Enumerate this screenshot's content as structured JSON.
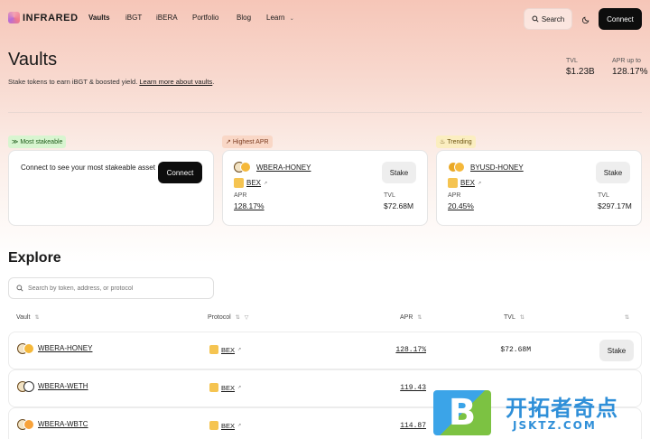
{
  "nav": {
    "logo_text": "INFRARED",
    "links": [
      "Vaults",
      "iBGT",
      "iBERA",
      "Portfolio",
      "Blog",
      "Learn"
    ],
    "search_label": "Search",
    "connect_label": "Connect"
  },
  "header": {
    "title": "Vaults",
    "subtitle": "Stake tokens to earn iBGT & boosted yield.",
    "learn_more": "Learn more about vaults",
    "tvl_label": "TVL",
    "tvl_value": "$1.23B",
    "apr_label": "APR up to",
    "apr_value": "128.17%"
  },
  "cards": {
    "most_stakeable": {
      "tag": "Most stakeable",
      "text": "Connect to see your most stakeable asset",
      "button": "Connect"
    },
    "highest_apr": {
      "tag": "Highest APR",
      "pair": "WBERA-HONEY",
      "protocol": "BEX",
      "button": "Stake",
      "apr_label": "APR",
      "apr_value": "128.17%",
      "tvl_label": "TVL",
      "tvl_value": "$72.68M"
    },
    "trending": {
      "tag": "Trending",
      "pair": "BYUSD-HONEY",
      "protocol": "BEX",
      "button": "Stake",
      "apr_label": "APR",
      "apr_value": "20.45%",
      "tvl_label": "TVL",
      "tvl_value": "$297.17M"
    }
  },
  "explore": {
    "title": "Explore",
    "search_placeholder": "Search by token, address, or protocol",
    "columns": {
      "vault": "Vault",
      "protocol": "Protocol",
      "apr": "APR",
      "tvl": "TVL"
    },
    "rows": [
      {
        "vault": "WBERA-HONEY",
        "protocol": "BEX",
        "apr": "128.17%",
        "tvl": "$72.68M",
        "action": "Stake"
      },
      {
        "vault": "WBERA-WETH",
        "protocol": "BEX",
        "apr": "119.43",
        "tvl": "",
        "action": ""
      },
      {
        "vault": "WBERA-WBTC",
        "protocol": "BEX",
        "apr": "114.87",
        "tvl": "",
        "action": ""
      }
    ]
  },
  "watermark": {
    "letter": "B",
    "cn": "开拓者奇点",
    "domain": "JSKTZ.COM"
  }
}
